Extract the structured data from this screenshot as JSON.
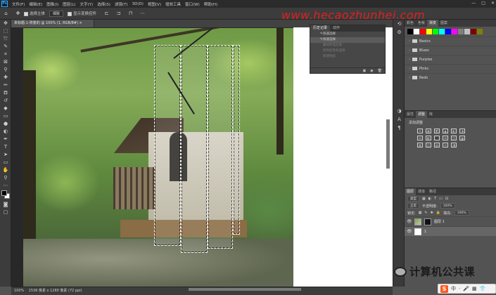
{
  "app": {
    "logo": "Ps"
  },
  "menubar": {
    "items": [
      "文件(F)",
      "编辑(E)",
      "图像(I)",
      "图层(L)",
      "文字(Y)",
      "选择(S)",
      "滤镜(T)",
      "3D(D)",
      "视图(V)",
      "增效工具",
      "窗口(W)",
      "帮助(H)"
    ],
    "window_controls": [
      "—",
      "□",
      "✕"
    ]
  },
  "options": {
    "tool_label": "选择主体",
    "mode_value": "细致",
    "checkbox_label": "显示变换控件",
    "watermark_url": "www.hecaozhunhei.com"
  },
  "document": {
    "tab_title": "未标题-1-恢复的 @ 100% (1, RGB/8#) ×"
  },
  "history": {
    "tabs": [
      "历史记录",
      "动作"
    ],
    "rows": [
      {
        "label": "快速选择",
        "state": "normal"
      },
      {
        "label": "快速选择",
        "state": "selected"
      },
      {
        "label": "删除所选区域",
        "state": "dim"
      },
      {
        "label": "修改前景色选择",
        "state": "dim"
      },
      {
        "label": "新建图层",
        "state": "dim"
      }
    ],
    "footer_icons": [
      "▣",
      "◉",
      "🗑"
    ]
  },
  "statusbar": {
    "zoom": "100%",
    "info": "1536 像素 x 1280 像素 (72 ppi)"
  },
  "swatches_panel": {
    "tabs": [
      "颜色",
      "色板",
      "渐变",
      "图案"
    ],
    "colors": [
      "#000000",
      "#ffffff",
      "#ff0000",
      "#ffff00",
      "#00ff00",
      "#00ffff",
      "#0000ff",
      "#ff00ff",
      "#808080",
      "#c0c0c0",
      "#800000",
      "#808000"
    ],
    "folders": [
      "Basics",
      "Blues",
      "Purples",
      "Pinks",
      "Reds"
    ]
  },
  "adjustments_panel": {
    "tabs": [
      "属性",
      "调整",
      "库"
    ],
    "label": "添加调整",
    "icons": [
      "☀",
      "▦",
      "◩",
      "▲",
      "◐",
      "◑",
      "⊟",
      "◧",
      "⬛",
      "⊞",
      "◳",
      "◪",
      "▥",
      "◫",
      "▤",
      "⊡",
      "◨"
    ]
  },
  "layers_panel": {
    "tabs": [
      "图层",
      "通道",
      "路径"
    ],
    "kind_label": "类型",
    "blend_mode": "正常",
    "opacity_label": "不透明度:",
    "opacity_value": "100%",
    "lock_label": "锁定:",
    "fill_label": "填充:",
    "fill_value": "100%",
    "layers": [
      {
        "name": "图层 1",
        "selected": false,
        "thumb": "photo"
      },
      {
        "name": "1",
        "selected": true,
        "thumb": "white"
      }
    ]
  },
  "watermark": {
    "wechat_text": "计算机公共课"
  },
  "ime": {
    "logo": "S",
    "icons": [
      "中",
      "·",
      "🎤",
      "▦",
      "👕"
    ]
  }
}
